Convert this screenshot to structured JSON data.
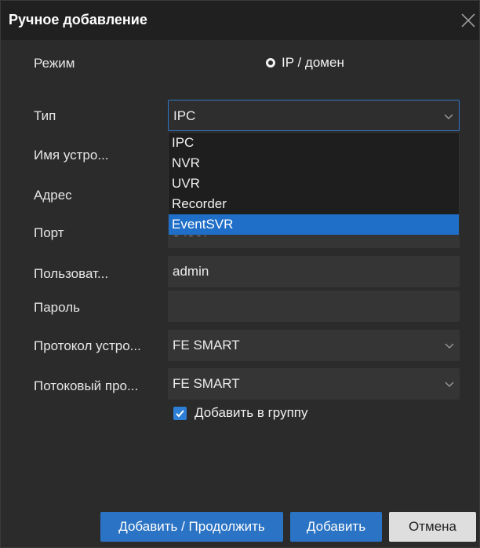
{
  "dialog": {
    "title": "Ручное добавление"
  },
  "form": {
    "mode": {
      "label": "Режим",
      "option": "IP / домен"
    },
    "type": {
      "label": "Тип",
      "value": "IPC",
      "options": [
        "IPC",
        "NVR",
        "UVR",
        "Recorder",
        "EventSVR"
      ],
      "highlighted": "EventSVR"
    },
    "device_name": {
      "label": "Имя устро..."
    },
    "address": {
      "label": "Адрес"
    },
    "port": {
      "label": "Порт",
      "value": "34567"
    },
    "user": {
      "label": "Пользоват...",
      "value": "admin"
    },
    "password": {
      "label": "Пароль",
      "value": ""
    },
    "device_protocol": {
      "label": "Протокол устро...",
      "value": "FE SMART"
    },
    "stream_protocol": {
      "label": "Потоковый про...",
      "value": "FE SMART"
    },
    "add_to_group": {
      "label": "Добавить в группу",
      "checked": true
    }
  },
  "buttons": {
    "add_continue": "Добавить / Продолжить",
    "add": "Добавить",
    "cancel": "Отмена"
  },
  "colors": {
    "accent": "#2b73c4",
    "dropdown_highlight": "#1f6fc8",
    "background": "#2b2b2b"
  },
  "icons": {
    "close": "close-icon",
    "chevron": "chevron-down-icon",
    "check": "checkmark-icon"
  }
}
